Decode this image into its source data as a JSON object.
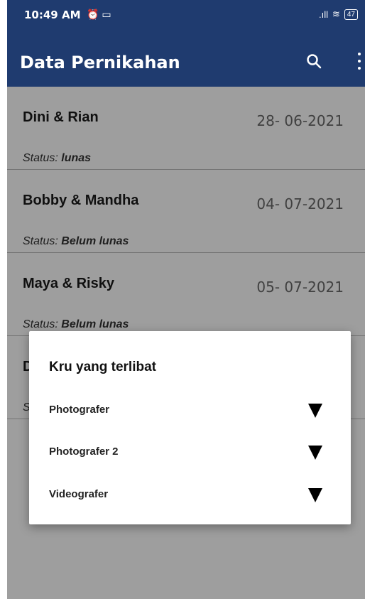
{
  "status_bar": {
    "time": "10:49 AM",
    "icons": "⏰ ▭",
    "signal": ".ıll",
    "wifi": "≋",
    "battery": "47"
  },
  "app_bar": {
    "title": "Data Pernikahan"
  },
  "list": {
    "status_prefix": "Status:",
    "items": [
      {
        "names": "Dini & Rian",
        "date": "28- 06-2021",
        "status": "lunas"
      },
      {
        "names": "Bobby & Mandha",
        "date": "04- 07-2021",
        "status": "Belum lunas"
      },
      {
        "names": "Maya & Risky",
        "date": "05- 07-2021",
        "status": "Belum lunas"
      },
      {
        "names": "D",
        "date": "",
        "status": ""
      }
    ],
    "partial_status_char": "S"
  },
  "dialog": {
    "title": "Kru yang terlibat",
    "rows": [
      {
        "label": "Photografer"
      },
      {
        "label": "Photografer 2"
      },
      {
        "label": "Videografer"
      }
    ]
  },
  "colors": {
    "app_bar": "#1f3b6f",
    "overlay": "rgba(0,0,0,0.38)",
    "dialog_bg": "#ffffff"
  }
}
